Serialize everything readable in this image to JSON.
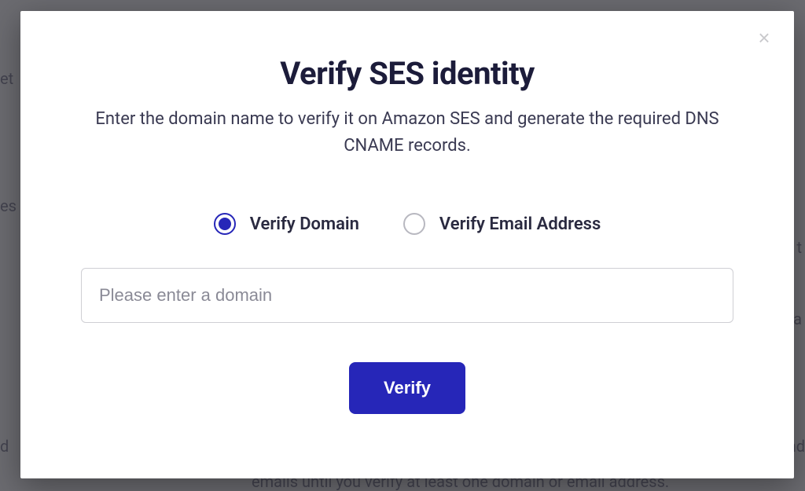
{
  "modal": {
    "title": "Verify SES identity",
    "subtitle": "Enter the domain name to verify it on Amazon SES and generate the required DNS CNAME records.",
    "close_icon": "×",
    "options": {
      "domain": {
        "label": "Verify Domain",
        "selected": true
      },
      "email": {
        "label": "Verify Email Address",
        "selected": false
      }
    },
    "input": {
      "value": "",
      "placeholder": "Please enter a domain"
    },
    "submit_label": "Verify"
  },
  "background": {
    "text_fragments": [
      "et",
      "es",
      "t",
      "a",
      "d",
      "nd",
      "emails until you verify at least one domain or email address."
    ]
  },
  "colors": {
    "accent": "#2626b8",
    "text_dark": "#1c1c3a",
    "overlay": "#6b6b70"
  }
}
